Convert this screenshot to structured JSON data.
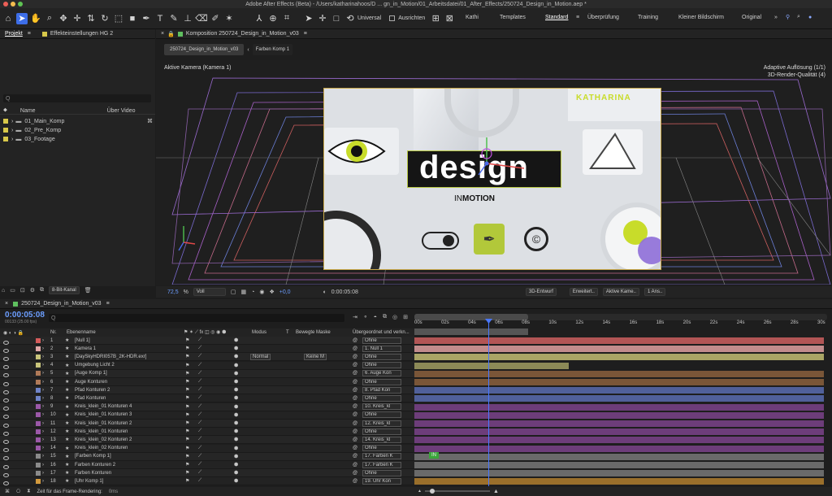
{
  "titlebar": {
    "text": "Adobe After Effects (Beta) - /Users/katharinahoos/D ... gn_in_Motion/01_Arbeitsdatei/01_After_Effects/250724_Design_in_Motion.aep *"
  },
  "toolbar": {
    "universal": "Universal",
    "align": "Ausrichten",
    "workspaces": [
      "Kathi",
      "Templates",
      "Standard",
      "Überprüfung",
      "Training",
      "Kleiner Bildschirm",
      "Original"
    ],
    "active_workspace": "Standard"
  },
  "project": {
    "tab": "Projekt",
    "effects_tab": "Effekteinstellungen HG 2",
    "search_placeholder": "Q",
    "col_name": "Name",
    "col_uber": "Über Video",
    "items": [
      "01_Main_Komp",
      "02_Pre_Komp",
      "03_Footage"
    ],
    "bit_depth": "8-Bit-Kanal"
  },
  "comp": {
    "tab": "Komposition 250724_Design_in_Motion_v03",
    "crumb1": "250724_Design_in_Motion_v03",
    "crumb2": "Farben Komp 1",
    "camera": "Aktive Kamera (Kamera 1)",
    "res": "Adaptive Auflösung (1/1)",
    "quality": "3D-Render-Qualität (4)",
    "card_design": "design",
    "card_in": "IN",
    "card_motion": "MOTION",
    "card_name": "KATHARINA",
    "zoom": "72,5",
    "zoom_unit": "%",
    "quality_select": "Voll",
    "exposure": "+0,0",
    "timecode": "0:00:05:08",
    "draft3d": "3D-Entwurf",
    "extended": "Erweitert..",
    "active_cam": "Aktive Kame..",
    "views": "1 Ans.."
  },
  "timeline": {
    "tab": "250724_Design_in_Motion_v03",
    "time": "0:00:05:08",
    "frames": "00133 (25.00 fps)",
    "search_placeholder": "Q",
    "cols": {
      "nr": "Nr.",
      "name": "Ebenenname",
      "mode": "Modus",
      "t": "T",
      "mask": "Bewegte Maske",
      "parent": "Übergeordnet und verkn..."
    },
    "ruler": [
      "00s",
      "02s",
      "04s",
      "06s",
      "08s",
      "10s",
      "12s",
      "14s",
      "16s",
      "18s",
      "20s",
      "22s",
      "24s",
      "26s",
      "28s",
      "30s"
    ],
    "layers": [
      {
        "nr": "1",
        "name": "[Null 1]",
        "color": "#d45b5b",
        "parent": "Ohne",
        "bar": "#b25555",
        "mode": "",
        "mask": ""
      },
      {
        "nr": "2",
        "name": "Kamera 1",
        "color": "#e0a8a8",
        "parent": "1. Null 1",
        "bar": "#c28c8c",
        "mode": "",
        "mask": ""
      },
      {
        "nr": "3",
        "name": "[DaySkyHDRI057B_2K-HDR.exr]",
        "color": "#c9c57b",
        "parent": "Ohne",
        "bar": "#aaa565",
        "mode": "Normal",
        "mask": "Keine M"
      },
      {
        "nr": "4",
        "name": "Umgebung Licht 2",
        "color": "#c9c57b",
        "parent": "Ohne",
        "bar": "#8c8a57",
        "mode": "",
        "mask": ""
      },
      {
        "nr": "5",
        "name": "[Auge Komp 1]",
        "color": "#b07a58",
        "parent": "6. Auge Kon",
        "bar": "#7a5638",
        "mode": "",
        "mask": ""
      },
      {
        "nr": "6",
        "name": "Auge Konturen",
        "color": "#b07a58",
        "parent": "Ohne",
        "bar": "#7a5638",
        "mode": "",
        "mask": ""
      },
      {
        "nr": "7",
        "name": "Pfad Konturen 2",
        "color": "#6f83c8",
        "parent": "8. Pfad Kon",
        "bar": "#50609a",
        "mode": "",
        "mask": ""
      },
      {
        "nr": "8",
        "name": "Pfad Konturen",
        "color": "#6f83c8",
        "parent": "Ohne",
        "bar": "#50609a",
        "mode": "",
        "mask": ""
      },
      {
        "nr": "9",
        "name": "Kreis_klein_01 Konturen 4",
        "color": "#9b58a8",
        "parent": "10. Kreis_kl",
        "bar": "#6d3d7a",
        "mode": "",
        "mask": ""
      },
      {
        "nr": "10",
        "name": "Kreis_klein_01 Konturen 3",
        "color": "#9b58a8",
        "parent": "Ohne",
        "bar": "#6d3d7a",
        "mode": "",
        "mask": ""
      },
      {
        "nr": "11",
        "name": "Kreis_klein_01 Konturen 2",
        "color": "#9b58a8",
        "parent": "12. Kreis_kl",
        "bar": "#6d3d7a",
        "mode": "",
        "mask": ""
      },
      {
        "nr": "12",
        "name": "Kreis_klein_01 Konturen",
        "color": "#9b58a8",
        "parent": "Ohne",
        "bar": "#6d3d7a",
        "mode": "",
        "mask": ""
      },
      {
        "nr": "13",
        "name": "Kreis_klein_02 Konturen 2",
        "color": "#9b58a8",
        "parent": "14. Kreis_kl",
        "bar": "#6d3d7a",
        "mode": "",
        "mask": ""
      },
      {
        "nr": "14",
        "name": "Kreis_klein_02 Konturen",
        "color": "#9b58a8",
        "parent": "Ohne",
        "bar": "#6d3d7a",
        "mode": "",
        "mask": ""
      },
      {
        "nr": "15",
        "name": "[Farben Komp 1]",
        "color": "#8a8a8a",
        "parent": "17. Farben K",
        "bar": "#6a6a6a",
        "mode": "",
        "mask": ""
      },
      {
        "nr": "16",
        "name": "Farben Konturen 2",
        "color": "#8a8a8a",
        "parent": "17. Farben K",
        "bar": "#6a6a6a",
        "mode": "",
        "mask": ""
      },
      {
        "nr": "17",
        "name": "Farben Konturen",
        "color": "#8a8a8a",
        "parent": "Ohne",
        "bar": "#6a6a6a",
        "mode": "",
        "mask": ""
      },
      {
        "nr": "18",
        "name": "[Uhr Komp 1]",
        "color": "#d39a3d",
        "parent": "19. Uhr Kon",
        "bar": "#9a6f2b",
        "mode": "",
        "mask": ""
      }
    ],
    "marker": "IN",
    "render_label": "Zeit für das Frame-Rendering:",
    "render_value": "0ms"
  }
}
